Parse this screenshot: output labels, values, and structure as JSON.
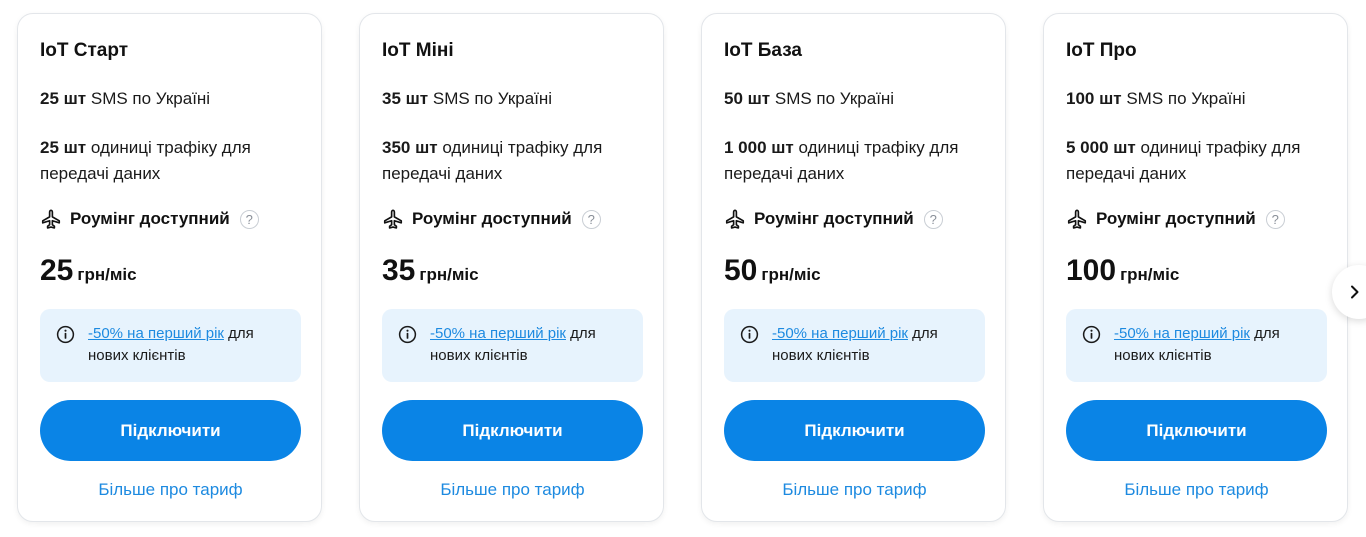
{
  "tariffs": [
    {
      "title": "IoT Старт",
      "sms_qty": "25 шт",
      "sms_text": " SMS по Україні",
      "traffic_qty": "25 шт",
      "traffic_text": " одиниці трафіку для передачі даних",
      "roaming_label": "Роумінг доступний",
      "price_amount": "25",
      "price_unit": "грн/міс",
      "promo_link": "-50% на перший рік",
      "promo_text": " для нових клієнтів",
      "button_label": "Підключити",
      "more_link": "Більше про тариф"
    },
    {
      "title": "IoT Міні",
      "sms_qty": "35 шт",
      "sms_text": " SMS по Україні",
      "traffic_qty": "350 шт",
      "traffic_text": " одиниці трафіку для передачі даних",
      "roaming_label": "Роумінг доступний",
      "price_amount": "35",
      "price_unit": "грн/міс",
      "promo_link": "-50% на перший рік",
      "promo_text": " для нових клієнтів",
      "button_label": "Підключити",
      "more_link": "Більше про тариф"
    },
    {
      "title": "IoT База",
      "sms_qty": "50 шт",
      "sms_text": " SMS по Україні",
      "traffic_qty": "1 000 шт",
      "traffic_text": " одиниці трафіку для передачі даних",
      "roaming_label": "Роумінг доступний",
      "price_amount": "50",
      "price_unit": "грн/міс",
      "promo_link": "-50% на перший рік",
      "promo_text": " для нових клієнтів",
      "button_label": "Підключити",
      "more_link": "Більше про тариф"
    },
    {
      "title": "IoT Про",
      "sms_qty": "100 шт",
      "sms_text": " SMS по Україні",
      "traffic_qty": "5 000 шт",
      "traffic_text": " одиниці трафіку для передачі даних",
      "roaming_label": "Роумінг доступний",
      "price_amount": "100",
      "price_unit": "грн/міс",
      "promo_link": "-50% на перший рік",
      "promo_text": " для нових клієнтів",
      "button_label": "Підключити",
      "more_link": "Більше про тариф"
    }
  ],
  "icons": {
    "roaming": "airplane-icon",
    "help": "question-mark-icon",
    "info": "info-icon",
    "next": "chevron-right-icon"
  },
  "help_glyph": "?",
  "colors": {
    "accent": "#0a84e6",
    "link": "#1d8ae0",
    "promo_bg": "#e7f3fd",
    "card_border": "#e3e6ea"
  }
}
